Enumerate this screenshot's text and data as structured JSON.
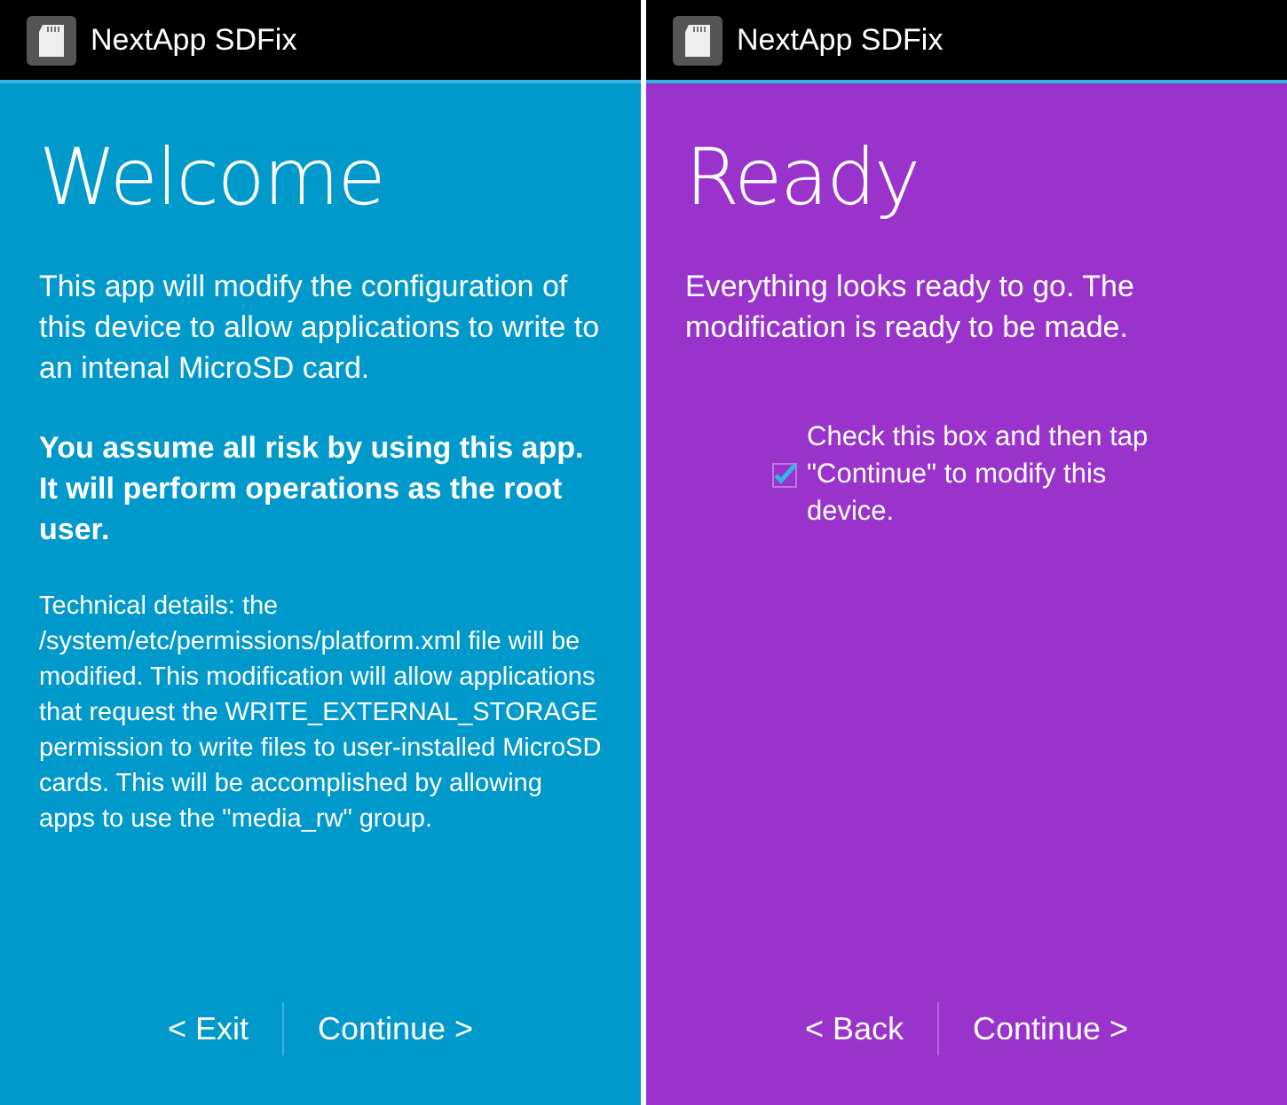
{
  "screens": [
    {
      "app_title": "NextApp SDFix",
      "color": "#0099cc",
      "heading": "Welcome",
      "paragraphs": [
        {
          "kind": "normal",
          "text": "This app will modify the configuration of this device to allow applications to write to an intenal MicroSD card."
        },
        {
          "kind": "bold",
          "text": "You assume all risk by using this app. It will perform operations as the root user."
        },
        {
          "kind": "small",
          "text": "Technical details: the /system/etc/permissions/platform.xml file will be modified. This modification will allow applications that request the WRITE_EXTERNAL_STORAGE permission to write files to user-installed MicroSD cards. This will be accomplished by allowing apps to use the \"media_rw\" group."
        }
      ],
      "buttons": [
        "< Exit",
        "Continue >"
      ]
    },
    {
      "app_title": "NextApp SDFix",
      "color": "#9933cc",
      "heading": "Ready",
      "paragraphs": [
        {
          "kind": "normal",
          "text": "Everything looks ready to go. The modification is ready to be made."
        }
      ],
      "checkbox": {
        "label": "Check this box and then tap \"Continue\" to modify this device.",
        "checked": true
      },
      "buttons": [
        "< Back",
        "Continue >"
      ]
    }
  ]
}
